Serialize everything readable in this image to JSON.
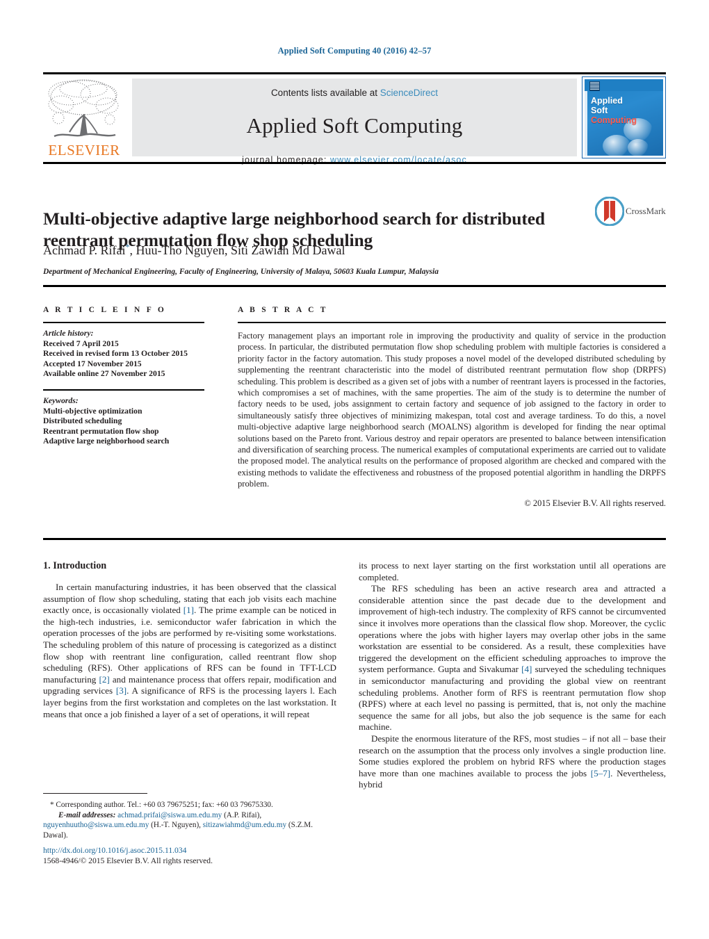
{
  "running_head": "Applied Soft Computing 40 (2016) 42–57",
  "masthead": {
    "publisher_name": "ELSEVIER",
    "contents_prefix": "Contents lists available at ",
    "contents_link": "ScienceDirect",
    "journal_title": "Applied Soft Computing",
    "homepage_prefix": "journal homepage: ",
    "homepage_url": "www.elsevier.com/locate/asoc",
    "cover": {
      "line1": "Applied",
      "line2": "Soft",
      "line3": "Computing"
    }
  },
  "article": {
    "title": "Multi-objective adaptive large neighborhood search for distributed reentrant permutation flow shop scheduling",
    "authors": "Achmad P. Rifai, Huu-Tho Nguyen, Siti Zawiah Md Dawal",
    "author_marker": "*",
    "affiliation": "Department of Mechanical Engineering, Faculty of Engineering, University of Malaya, 50603 Kuala Lumpur, Malaysia",
    "crossmark_label": "CrossMark"
  },
  "article_info": {
    "heading": "A R T I C L E   I N F O",
    "history_label": "Article history:",
    "history": [
      "Received 7 April 2015",
      "Received in revised form 13 October 2015",
      "Accepted 17 November 2015",
      "Available online 27 November 2015"
    ],
    "keywords_label": "Keywords:",
    "keywords": [
      "Multi-objective optimization",
      "Distributed scheduling",
      "Reentrant permutation flow shop",
      "Adaptive large neighborhood search"
    ]
  },
  "abstract": {
    "heading": "A B S T R A C T",
    "text": "Factory management plays an important role in improving the productivity and quality of service in the production process. In particular, the distributed permutation flow shop scheduling problem with multiple factories is considered a priority factor in the factory automation. This study proposes a novel model of the developed distributed scheduling by supplementing the reentrant characteristic into the model of distributed reentrant permutation flow shop (DRPFS) scheduling. This problem is described as a given set of jobs with a number of reentrant layers is processed in the factories, which compromises a set of machines, with the same properties. The aim of the study is to determine the number of factory needs to be used, jobs assignment to certain factory and sequence of job assigned to the factory in order to simultaneously satisfy three objectives of minimizing makespan, total cost and average tardiness. To do this, a novel multi-objective adaptive large neighborhood search (MOALNS) algorithm is developed for finding the near optimal solutions based on the Pareto front. Various destroy and repair operators are presented to balance between intensification and diversification of searching process. The numerical examples of computational experiments are carried out to validate the proposed model. The analytical results on the performance of proposed algorithm are checked and compared with the existing methods to validate the effectiveness and robustness of the proposed potential algorithm in handling the DRPFS problem.",
    "copyright": "© 2015 Elsevier B.V. All rights reserved."
  },
  "body": {
    "section_heading": "1. Introduction",
    "left": {
      "p1_a": "In certain manufacturing industries, it has been observed that the classical assumption of flow shop scheduling, stating that each job visits each machine exactly once, is occasionally violated ",
      "p1_ref1": "[1]",
      "p1_b": ". The prime example can be noticed in the high-tech industries, i.e. semiconductor wafer fabrication in which the operation processes of the jobs are performed by re-visiting some workstations. The scheduling problem of this nature of processing is categorized as a distinct flow shop with reentrant line configuration, called reentrant flow shop scheduling (RFS). Other applications of RFS can be found in TFT-LCD manufacturing ",
      "p1_ref2": "[2]",
      "p1_c": " and maintenance process that offers repair, modification and upgrading services ",
      "p1_ref3": "[3]",
      "p1_d": ". A significance of RFS is the processing layers l. Each layer begins from the first workstation and completes on the last workstation. It means that once a job finished a layer of a set of operations, it will repeat"
    },
    "right": {
      "p1": "its process to next layer starting on the first workstation until all operations are completed.",
      "p2_a": "The RFS scheduling has been an active research area and attracted a considerable attention since the past decade due to the development and improvement of high-tech industry. The complexity of RFS cannot be circumvented since it involves more operations than the classical flow shop. Moreover, the cyclic operations where the jobs with higher layers may overlap other jobs in the same workstation are essential to be considered. As a result, these complexities have triggered the development on the efficient scheduling approaches to improve the system performance. Gupta and Sivakumar ",
      "p2_ref": "[4]",
      "p2_b": " surveyed the scheduling techniques in semiconductor manufacturing and providing the global view on reentrant scheduling problems. Another form of RFS is reentrant permutation flow shop (RPFS) where at each level no passing is permitted, that is, not only the machine sequence the same for all jobs, but also the job sequence is the same for each machine.",
      "p3_a": "Despite the enormous literature of the RFS, most studies – if not all – base their research on the assumption that the process only involves a single production line. Some studies explored the problem on hybrid RFS where the production stages have more than one machines available to process the jobs ",
      "p3_ref": "[5–7]",
      "p3_b": ". Nevertheless, hybrid"
    }
  },
  "footnotes": {
    "corresponding": "* Corresponding author. Tel.: +60 03 79675251; fax: +60 03 79675330.",
    "email_label": "E-mail addresses:",
    "email1": "achmad.prifai@siswa.um.edu.my",
    "email1_owner": " (A.P. Rifai),",
    "email2": "nguyenhuutho@siswa.um.edu.my",
    "email2_owner": " (H.-T. Nguyen),",
    "email3": "sitizawiahmd@um.edu.my",
    "email3_owner": "(S.Z.M. Dawal).",
    "doi": "http://dx.doi.org/10.1016/j.asoc.2015.11.034",
    "issn_line": "1568-4946/© 2015 Elsevier B.V. All rights reserved."
  },
  "colors": {
    "link": "#1a6496",
    "band": "#e6e7e8",
    "elsevier_orange": "#E87722",
    "cover_blue": "#1f7fc4",
    "cover_red": "#ff5a4d"
  }
}
